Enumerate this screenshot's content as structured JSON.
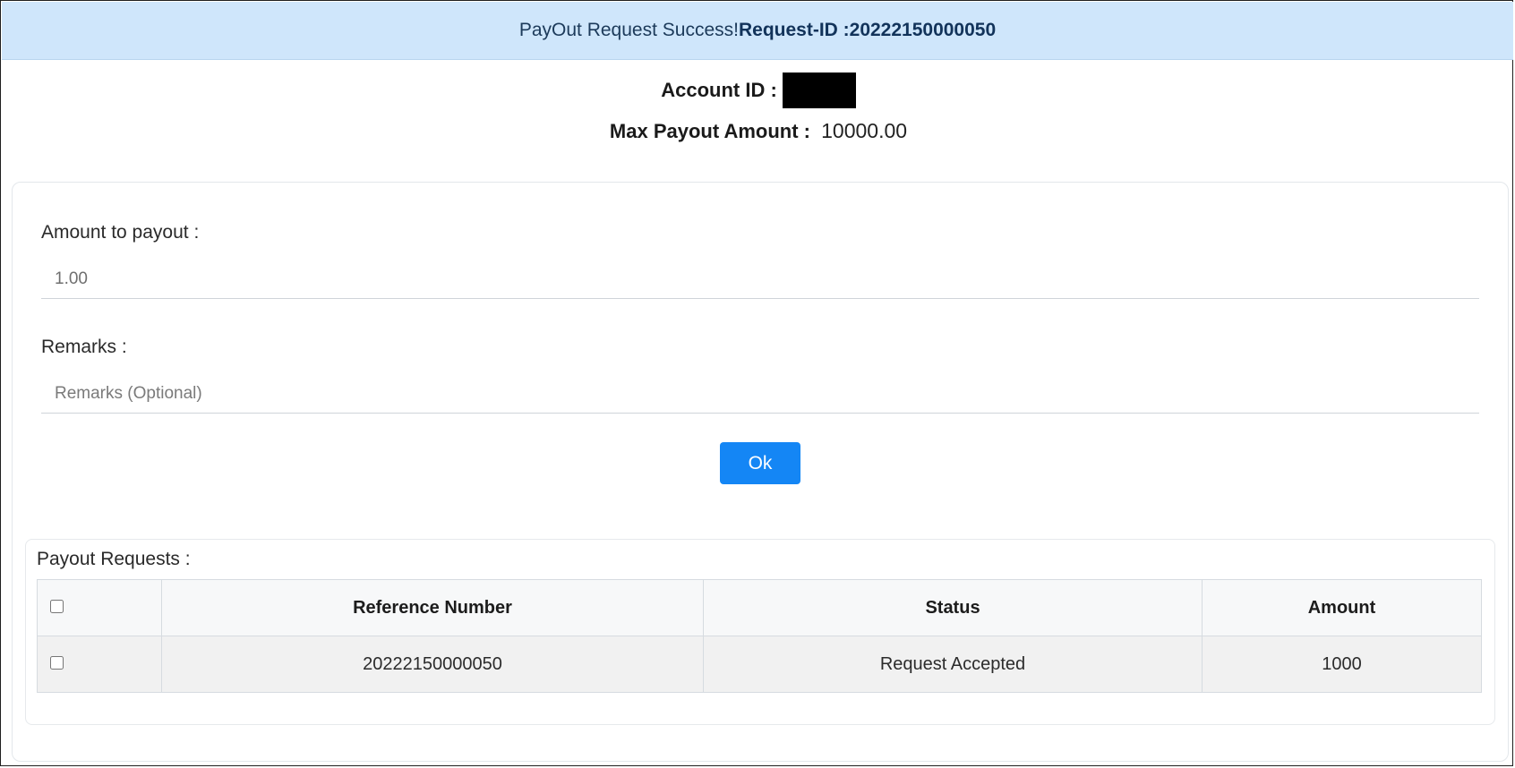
{
  "banner": {
    "success_text": "PayOut Request Success!",
    "request_id_text": "Request-ID :20222150000050"
  },
  "account": {
    "account_id_label": "Account ID :",
    "max_payout_label": "Max Payout Amount :",
    "max_payout_value": "10000.00"
  },
  "form": {
    "amount_label": "Amount to payout :",
    "amount_value": "1.00",
    "remarks_label": "Remarks :",
    "remarks_placeholder": "Remarks (Optional)",
    "ok_label": "Ok"
  },
  "requests": {
    "title": "Payout Requests :",
    "columns": [
      "Reference Number",
      "Status",
      "Amount"
    ],
    "rows": [
      {
        "reference": "20222150000050",
        "status": "Request Accepted",
        "amount": "1000"
      }
    ]
  },
  "colors": {
    "banner_bg": "#cfe6fb",
    "button_bg": "#1486f5"
  }
}
